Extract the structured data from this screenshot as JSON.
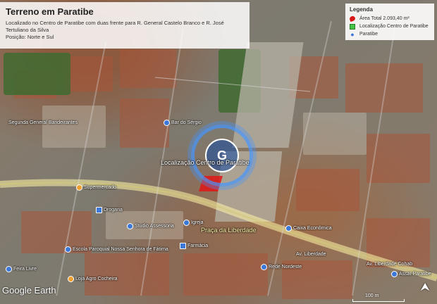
{
  "title": {
    "heading": "Terreno em Paratibe",
    "line1": "Localizado no Centro de Paratibe com duas frente para R. General Castelo Branco e R. José Tertuliano da Silva",
    "line2": "Posição: Norte e Sul"
  },
  "legend": {
    "heading": "Legenda",
    "items": [
      {
        "label": "Área Total 2.093,40 m²",
        "icon": "red-area-icon"
      },
      {
        "label": "Localização Centro de Paratibe",
        "icon": "green-square-icon"
      },
      {
        "label": "Paratibe",
        "icon": "map-pin-icon"
      }
    ]
  },
  "map": {
    "target_label": "Localização Centro de Paratibe",
    "road_labels": [
      "Praça da Liberdade",
      "Av. Liberdade",
      "Av. Liberdade Cohab",
      "Segunda General Bandeirantes"
    ],
    "place_labels": [
      "Escola Paroquial Nossa Senhora de Fátima",
      "Feira Livre",
      "Studio Assessoria",
      "Farmácia",
      "Igreja",
      "Rede Nordeste",
      "Loja Agro Cocheira",
      "Drogaria",
      "Assaí Paratibe",
      "Caixa Econômica",
      "Supermercado",
      "Bar do Sérgio"
    ],
    "logo": "Google Earth",
    "scale": "100 m",
    "colors": {
      "target_ring": "#4696ff",
      "area_fill": "#e01818",
      "road_highlight": "#fff6a8"
    }
  }
}
